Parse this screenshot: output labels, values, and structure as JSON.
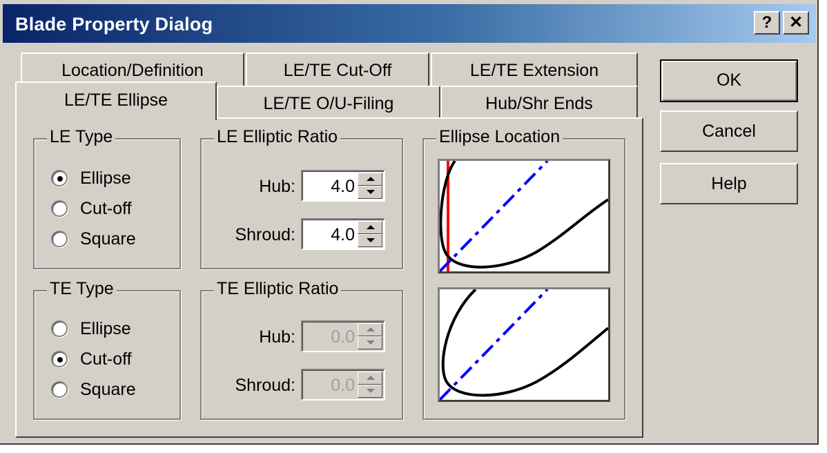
{
  "window": {
    "title": "Blade Property Dialog",
    "help_glyph": "?",
    "close_glyph": "✕"
  },
  "tabs": {
    "row_back": [
      "Location/Definition",
      "LE/TE Cut-Off",
      "LE/TE Extension"
    ],
    "row_front": [
      "LE/TE Ellipse",
      "LE/TE O/U-Filing",
      "Hub/Shr Ends"
    ],
    "active": "LE/TE Ellipse"
  },
  "le_type": {
    "title": "LE Type",
    "options": [
      "Ellipse",
      "Cut-off",
      "Square"
    ],
    "selected": "Ellipse"
  },
  "te_type": {
    "title": "TE Type",
    "options": [
      "Ellipse",
      "Cut-off",
      "Square"
    ],
    "selected": "Cut-off"
  },
  "le_ratio": {
    "title": "LE Elliptic Ratio",
    "hub_label": "Hub:",
    "hub_value": "4.0",
    "shroud_label": "Shroud:",
    "shroud_value": "4.0",
    "enabled": true
  },
  "te_ratio": {
    "title": "TE Elliptic Ratio",
    "hub_label": "Hub:",
    "hub_value": "0.0",
    "shroud_label": "Shroud:",
    "shroud_value": "0.0",
    "enabled": false
  },
  "ellipse_location": {
    "title": "Ellipse Location"
  },
  "buttons": {
    "ok": "OK",
    "cancel": "Cancel",
    "help": "Help"
  },
  "colors": {
    "title_start": "#0a246a",
    "title_end": "#a6caf0",
    "face": "#d4d0c8",
    "curve": "#000000",
    "axis": "#0000ff",
    "marker": "#ff0000"
  }
}
